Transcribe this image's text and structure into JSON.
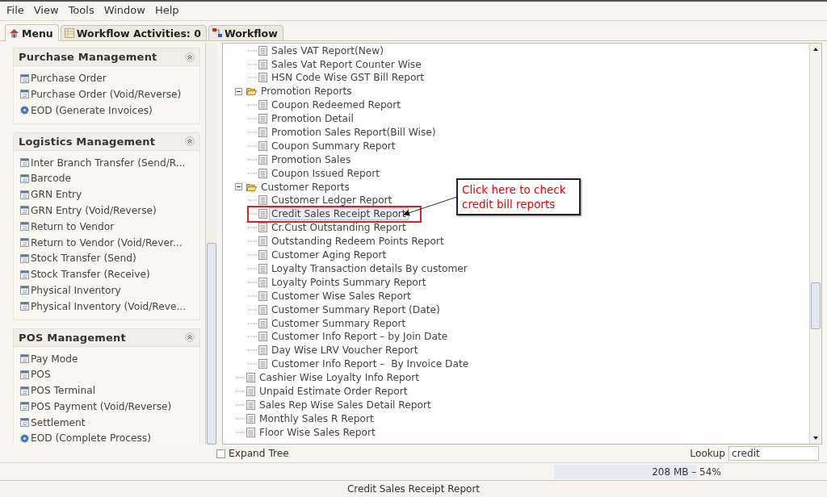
{
  "menu_bar": [
    "File",
    "View",
    "Tools",
    "Window",
    "Help"
  ],
  "tabs": [
    {
      "label": "Menu",
      "kind": "menu",
      "selected": true
    },
    {
      "label": "Workflow Activities: 0",
      "kind": "activities",
      "selected": false
    },
    {
      "label": "Workflow",
      "kind": "workflow",
      "selected": false
    }
  ],
  "sidebar": {
    "sections": [
      {
        "title": "Purchase Management",
        "expanded": true,
        "items": [
          {
            "label": "Purchase Order",
            "kind": "form"
          },
          {
            "label": "Purchase Order (Void/Reverse)",
            "kind": "form"
          },
          {
            "label": "EOD (Generate Invoices)",
            "kind": "process"
          }
        ]
      },
      {
        "title": "Logistics Management",
        "expanded": true,
        "items": [
          {
            "label": "Inter Branch Transfer (Send/R...",
            "kind": "form"
          },
          {
            "label": "Barcode",
            "kind": "form"
          },
          {
            "label": "GRN Entry",
            "kind": "form"
          },
          {
            "label": "GRN Entry (Void/Reverse)",
            "kind": "form"
          },
          {
            "label": "Return to Vendor",
            "kind": "form"
          },
          {
            "label": "Return to Vendor (Void/Rever...",
            "kind": "form"
          },
          {
            "label": "Stock Transfer (Send)",
            "kind": "form"
          },
          {
            "label": "Stock Transfer (Receive)",
            "kind": "form"
          },
          {
            "label": "Physical Inventory",
            "kind": "form"
          },
          {
            "label": "Physical Inventory (Void/Reve...",
            "kind": "form"
          }
        ]
      },
      {
        "title": "POS Management",
        "expanded": true,
        "items": [
          {
            "label": "Pay Mode",
            "kind": "form"
          },
          {
            "label": "POS",
            "kind": "form"
          },
          {
            "label": "POS Terminal",
            "kind": "form"
          },
          {
            "label": "POS Payment (Void/Reverse)",
            "kind": "form"
          },
          {
            "label": "Settlement",
            "kind": "form"
          },
          {
            "label": "EOD (Complete Process)",
            "kind": "process"
          }
        ]
      }
    ]
  },
  "tree": {
    "nodes": [
      {
        "kind": "continued",
        "children": [
          {
            "kind": "report",
            "label": "Sales VAT Report(New)",
            "selected": false
          },
          {
            "kind": "report",
            "label": "Sales Vat Report Counter Wise",
            "selected": false
          },
          {
            "kind": "report",
            "label": "HSN Code Wise GST Bill Report",
            "selected": false
          }
        ]
      },
      {
        "kind": "folder",
        "label": "Promotion Reports",
        "expanded": true,
        "children": [
          {
            "kind": "report",
            "label": "Coupon Redeemed Report",
            "selected": false
          },
          {
            "kind": "report",
            "label": "Promotion Detail",
            "selected": false
          },
          {
            "kind": "report",
            "label": "Promotion Sales Report(Bill Wise)",
            "selected": false
          },
          {
            "kind": "report",
            "label": "Coupon Summary Report",
            "selected": false
          },
          {
            "kind": "report",
            "label": "Promotion Sales",
            "selected": false
          },
          {
            "kind": "report",
            "label": "Coupon Issued Report",
            "selected": false
          }
        ]
      },
      {
        "kind": "folder",
        "label": "Customer Reports",
        "expanded": true,
        "children": [
          {
            "kind": "report",
            "label": "Customer Ledger Report",
            "selected": false
          },
          {
            "kind": "report",
            "label": "Credit Sales Receipt Report",
            "selected": true
          },
          {
            "kind": "report",
            "label": "Cr.Cust Outstanding Report",
            "selected": false
          },
          {
            "kind": "report",
            "label": "Outstanding Redeem Points Report",
            "selected": false
          },
          {
            "kind": "report",
            "label": "Customer Aging Report",
            "selected": false
          },
          {
            "kind": "report",
            "label": "Loyalty Transaction details By customer",
            "selected": false
          },
          {
            "kind": "report",
            "label": "Loyalty Points Summary Report",
            "selected": false
          },
          {
            "kind": "report",
            "label": "Customer Wise Sales Report",
            "selected": false
          },
          {
            "kind": "report",
            "label": "Customer Summary Report (Date)",
            "selected": false
          },
          {
            "kind": "report",
            "label": "Customer Summary Report",
            "selected": false
          },
          {
            "kind": "report",
            "label": "Customer Info Report – by Join Date",
            "selected": false
          },
          {
            "kind": "report",
            "label": "Day Wise LRV Voucher Report",
            "selected": false
          },
          {
            "kind": "report",
            "label": "Customer Info Report –  By Invoice Date",
            "selected": false
          }
        ]
      },
      {
        "kind": "report",
        "label": "Cashier Wise Loyalty Info Report",
        "selected": false
      },
      {
        "kind": "report",
        "label": "Unpaid Estimate Order Report",
        "selected": false
      },
      {
        "kind": "report",
        "label": "Sales Rep Wise Sales Detail Report",
        "selected": false
      },
      {
        "kind": "report",
        "label": "Monthly Sales R Report",
        "selected": false
      },
      {
        "kind": "report",
        "label": "Floor Wise Sales Report",
        "selected": false
      }
    ]
  },
  "annotation": {
    "text": "Click here to check\ncredit bill reports"
  },
  "expand_tree": {
    "label": "Expand Tree",
    "checked": false
  },
  "lookup": {
    "label": "Lookup",
    "value": "credit"
  },
  "memory": {
    "text": "208 MB – 54%",
    "level": 0.54
  },
  "status_bar": "Credit Sales Receipt Report"
}
